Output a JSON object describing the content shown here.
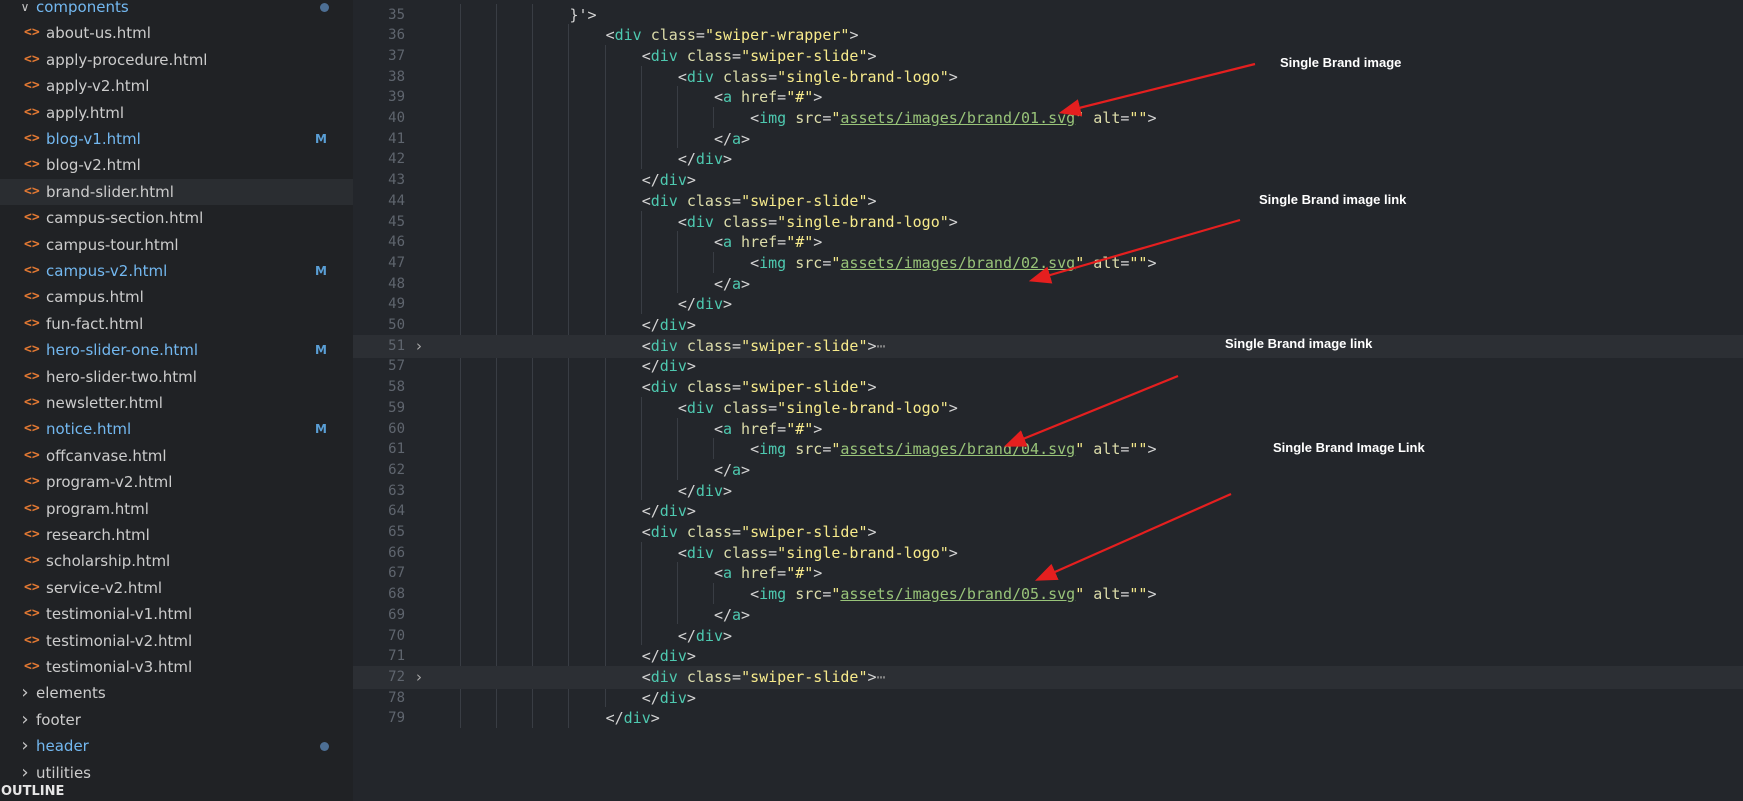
{
  "explorer": {
    "top_folder": "components",
    "files": [
      {
        "name": "about-us.html",
        "status": ""
      },
      {
        "name": "apply-procedure.html",
        "status": ""
      },
      {
        "name": "apply-v2.html",
        "status": ""
      },
      {
        "name": "apply.html",
        "status": ""
      },
      {
        "name": "blog-v1.html",
        "status": "M"
      },
      {
        "name": "blog-v2.html",
        "status": ""
      },
      {
        "name": "brand-slider.html",
        "status": ""
      },
      {
        "name": "campus-section.html",
        "status": ""
      },
      {
        "name": "campus-tour.html",
        "status": ""
      },
      {
        "name": "campus-v2.html",
        "status": "M"
      },
      {
        "name": "campus.html",
        "status": ""
      },
      {
        "name": "fun-fact.html",
        "status": ""
      },
      {
        "name": "hero-slider-one.html",
        "status": "M"
      },
      {
        "name": "hero-slider-two.html",
        "status": ""
      },
      {
        "name": "newsletter.html",
        "status": ""
      },
      {
        "name": "notice.html",
        "status": "M"
      },
      {
        "name": "offcanvase.html",
        "status": ""
      },
      {
        "name": "program-v2.html",
        "status": ""
      },
      {
        "name": "program.html",
        "status": ""
      },
      {
        "name": "research.html",
        "status": ""
      },
      {
        "name": "scholarship.html",
        "status": ""
      },
      {
        "name": "service-v2.html",
        "status": ""
      },
      {
        "name": "testimonial-v1.html",
        "status": ""
      },
      {
        "name": "testimonial-v2.html",
        "status": ""
      },
      {
        "name": "testimonial-v3.html",
        "status": ""
      }
    ],
    "folders": [
      {
        "name": "elements",
        "modified": false
      },
      {
        "name": "footer",
        "modified": false
      },
      {
        "name": "header",
        "modified": true
      },
      {
        "name": "utilities",
        "modified": false
      }
    ],
    "selected_file": "brand-slider.html",
    "outline_label": "OUTLINE"
  },
  "editor": {
    "lines": [
      {
        "num": "35",
        "indent": 4,
        "tokens": [
          [
            "p",
            "}'>"
          ]
        ]
      },
      {
        "num": "36",
        "indent": 5,
        "tokens": [
          [
            "p",
            "<"
          ],
          [
            "t",
            "div"
          ],
          [
            "p",
            " "
          ],
          [
            "a",
            "class"
          ],
          [
            "p",
            "="
          ],
          [
            "s",
            "\"swiper-wrapper\""
          ],
          [
            "p",
            ">"
          ]
        ]
      },
      {
        "num": "37",
        "indent": 6,
        "tokens": [
          [
            "p",
            "<"
          ],
          [
            "t",
            "div"
          ],
          [
            "p",
            " "
          ],
          [
            "a",
            "class"
          ],
          [
            "p",
            "="
          ],
          [
            "s",
            "\"swiper-slide\""
          ],
          [
            "p",
            ">"
          ]
        ]
      },
      {
        "num": "38",
        "indent": 7,
        "tokens": [
          [
            "p",
            "<"
          ],
          [
            "t",
            "div"
          ],
          [
            "p",
            " "
          ],
          [
            "a",
            "class"
          ],
          [
            "p",
            "="
          ],
          [
            "s",
            "\"single-brand-logo\""
          ],
          [
            "p",
            ">"
          ]
        ]
      },
      {
        "num": "39",
        "indent": 8,
        "tokens": [
          [
            "p",
            "<"
          ],
          [
            "t",
            "a"
          ],
          [
            "p",
            " "
          ],
          [
            "a",
            "href"
          ],
          [
            "p",
            "="
          ],
          [
            "s",
            "\"#\""
          ],
          [
            "p",
            ">"
          ]
        ]
      },
      {
        "num": "40",
        "indent": 9,
        "tokens": [
          [
            "p",
            "<"
          ],
          [
            "t",
            "img"
          ],
          [
            "p",
            " "
          ],
          [
            "a",
            "src"
          ],
          [
            "p",
            "="
          ],
          [
            "s",
            "\""
          ],
          [
            "sl",
            "assets/images/brand/01.svg"
          ],
          [
            "s",
            "\""
          ],
          [
            "p",
            " "
          ],
          [
            "a",
            "alt"
          ],
          [
            "p",
            "="
          ],
          [
            "s",
            "\"\""
          ],
          [
            "p",
            ">"
          ]
        ]
      },
      {
        "num": "41",
        "indent": 8,
        "tokens": [
          [
            "p",
            "</"
          ],
          [
            "t",
            "a"
          ],
          [
            "p",
            ">"
          ]
        ]
      },
      {
        "num": "42",
        "indent": 7,
        "tokens": [
          [
            "p",
            "</"
          ],
          [
            "t",
            "div"
          ],
          [
            "p",
            ">"
          ]
        ]
      },
      {
        "num": "43",
        "indent": 6,
        "tokens": [
          [
            "p",
            "</"
          ],
          [
            "t",
            "div"
          ],
          [
            "p",
            ">"
          ]
        ]
      },
      {
        "num": "44",
        "indent": 6,
        "tokens": [
          [
            "p",
            "<"
          ],
          [
            "t",
            "div"
          ],
          [
            "p",
            " "
          ],
          [
            "a",
            "class"
          ],
          [
            "p",
            "="
          ],
          [
            "s",
            "\"swiper-slide\""
          ],
          [
            "p",
            ">"
          ]
        ]
      },
      {
        "num": "45",
        "indent": 7,
        "tokens": [
          [
            "p",
            "<"
          ],
          [
            "t",
            "div"
          ],
          [
            "p",
            " "
          ],
          [
            "a",
            "class"
          ],
          [
            "p",
            "="
          ],
          [
            "s",
            "\"single-brand-logo\""
          ],
          [
            "p",
            ">"
          ]
        ]
      },
      {
        "num": "46",
        "indent": 8,
        "tokens": [
          [
            "p",
            "<"
          ],
          [
            "t",
            "a"
          ],
          [
            "p",
            " "
          ],
          [
            "a",
            "href"
          ],
          [
            "p",
            "="
          ],
          [
            "s",
            "\"#\""
          ],
          [
            "p",
            ">"
          ]
        ]
      },
      {
        "num": "47",
        "indent": 9,
        "tokens": [
          [
            "p",
            "<"
          ],
          [
            "t",
            "img"
          ],
          [
            "p",
            " "
          ],
          [
            "a",
            "src"
          ],
          [
            "p",
            "="
          ],
          [
            "s",
            "\""
          ],
          [
            "sl",
            "assets/images/brand/02.svg"
          ],
          [
            "s",
            "\""
          ],
          [
            "p",
            " "
          ],
          [
            "a",
            "alt"
          ],
          [
            "p",
            "="
          ],
          [
            "s",
            "\"\""
          ],
          [
            "p",
            ">"
          ]
        ]
      },
      {
        "num": "48",
        "indent": 8,
        "tokens": [
          [
            "p",
            "</"
          ],
          [
            "t",
            "a"
          ],
          [
            "p",
            ">"
          ]
        ]
      },
      {
        "num": "49",
        "indent": 7,
        "tokens": [
          [
            "p",
            "</"
          ],
          [
            "t",
            "div"
          ],
          [
            "p",
            ">"
          ]
        ]
      },
      {
        "num": "50",
        "indent": 6,
        "tokens": [
          [
            "p",
            "</"
          ],
          [
            "t",
            "div"
          ],
          [
            "p",
            ">"
          ]
        ]
      },
      {
        "num": "51",
        "indent": 6,
        "folded": true,
        "tokens": [
          [
            "p",
            "<"
          ],
          [
            "t",
            "div"
          ],
          [
            "p",
            " "
          ],
          [
            "a",
            "class"
          ],
          [
            "p",
            "="
          ],
          [
            "s",
            "\"swiper-slide\""
          ],
          [
            "p",
            ">"
          ],
          [
            "e",
            "⋯"
          ]
        ]
      },
      {
        "num": "57",
        "indent": 6,
        "tokens": [
          [
            "p",
            "</"
          ],
          [
            "t",
            "div"
          ],
          [
            "p",
            ">"
          ]
        ]
      },
      {
        "num": "58",
        "indent": 6,
        "tokens": [
          [
            "p",
            "<"
          ],
          [
            "t",
            "div"
          ],
          [
            "p",
            " "
          ],
          [
            "a",
            "class"
          ],
          [
            "p",
            "="
          ],
          [
            "s",
            "\"swiper-slide\""
          ],
          [
            "p",
            ">"
          ]
        ]
      },
      {
        "num": "59",
        "indent": 7,
        "tokens": [
          [
            "p",
            "<"
          ],
          [
            "t",
            "div"
          ],
          [
            "p",
            " "
          ],
          [
            "a",
            "class"
          ],
          [
            "p",
            "="
          ],
          [
            "s",
            "\"single-brand-logo\""
          ],
          [
            "p",
            ">"
          ]
        ]
      },
      {
        "num": "60",
        "indent": 8,
        "tokens": [
          [
            "p",
            "<"
          ],
          [
            "t",
            "a"
          ],
          [
            "p",
            " "
          ],
          [
            "a",
            "href"
          ],
          [
            "p",
            "="
          ],
          [
            "s",
            "\"#\""
          ],
          [
            "p",
            ">"
          ]
        ]
      },
      {
        "num": "61",
        "indent": 9,
        "tokens": [
          [
            "p",
            "<"
          ],
          [
            "t",
            "img"
          ],
          [
            "p",
            " "
          ],
          [
            "a",
            "src"
          ],
          [
            "p",
            "="
          ],
          [
            "s",
            "\""
          ],
          [
            "sl",
            "assets/images/brand/04.svg"
          ],
          [
            "s",
            "\""
          ],
          [
            "p",
            " "
          ],
          [
            "a",
            "alt"
          ],
          [
            "p",
            "="
          ],
          [
            "s",
            "\"\""
          ],
          [
            "p",
            ">"
          ]
        ]
      },
      {
        "num": "62",
        "indent": 8,
        "tokens": [
          [
            "p",
            "</"
          ],
          [
            "t",
            "a"
          ],
          [
            "p",
            ">"
          ]
        ]
      },
      {
        "num": "63",
        "indent": 7,
        "tokens": [
          [
            "p",
            "</"
          ],
          [
            "t",
            "div"
          ],
          [
            "p",
            ">"
          ]
        ]
      },
      {
        "num": "64",
        "indent": 6,
        "tokens": [
          [
            "p",
            "</"
          ],
          [
            "t",
            "div"
          ],
          [
            "p",
            ">"
          ]
        ]
      },
      {
        "num": "65",
        "indent": 6,
        "tokens": [
          [
            "p",
            "<"
          ],
          [
            "t",
            "div"
          ],
          [
            "p",
            " "
          ],
          [
            "a",
            "class"
          ],
          [
            "p",
            "="
          ],
          [
            "s",
            "\"swiper-slide\""
          ],
          [
            "p",
            ">"
          ]
        ]
      },
      {
        "num": "66",
        "indent": 7,
        "tokens": [
          [
            "p",
            "<"
          ],
          [
            "t",
            "div"
          ],
          [
            "p",
            " "
          ],
          [
            "a",
            "class"
          ],
          [
            "p",
            "="
          ],
          [
            "s",
            "\"single-brand-logo\""
          ],
          [
            "p",
            ">"
          ]
        ]
      },
      {
        "num": "67",
        "indent": 8,
        "tokens": [
          [
            "p",
            "<"
          ],
          [
            "t",
            "a"
          ],
          [
            "p",
            " "
          ],
          [
            "a",
            "href"
          ],
          [
            "p",
            "="
          ],
          [
            "s",
            "\"#\""
          ],
          [
            "p",
            ">"
          ]
        ]
      },
      {
        "num": "68",
        "indent": 9,
        "tokens": [
          [
            "p",
            "<"
          ],
          [
            "t",
            "img"
          ],
          [
            "p",
            " "
          ],
          [
            "a",
            "src"
          ],
          [
            "p",
            "="
          ],
          [
            "s",
            "\""
          ],
          [
            "sl",
            "assets/images/brand/05.svg"
          ],
          [
            "s",
            "\""
          ],
          [
            "p",
            " "
          ],
          [
            "a",
            "alt"
          ],
          [
            "p",
            "="
          ],
          [
            "s",
            "\"\""
          ],
          [
            "p",
            ">"
          ]
        ]
      },
      {
        "num": "69",
        "indent": 8,
        "tokens": [
          [
            "p",
            "</"
          ],
          [
            "t",
            "a"
          ],
          [
            "p",
            ">"
          ]
        ]
      },
      {
        "num": "70",
        "indent": 7,
        "tokens": [
          [
            "p",
            "</"
          ],
          [
            "t",
            "div"
          ],
          [
            "p",
            ">"
          ]
        ]
      },
      {
        "num": "71",
        "indent": 6,
        "tokens": [
          [
            "p",
            "</"
          ],
          [
            "t",
            "div"
          ],
          [
            "p",
            ">"
          ]
        ]
      },
      {
        "num": "72",
        "indent": 6,
        "folded": true,
        "tokens": [
          [
            "p",
            "<"
          ],
          [
            "t",
            "div"
          ],
          [
            "p",
            " "
          ],
          [
            "a",
            "class"
          ],
          [
            "p",
            "="
          ],
          [
            "s",
            "\"swiper-slide\""
          ],
          [
            "p",
            ">"
          ],
          [
            "e",
            "⋯"
          ]
        ]
      },
      {
        "num": "78",
        "indent": 6,
        "tokens": [
          [
            "p",
            "</"
          ],
          [
            "t",
            "div"
          ],
          [
            "p",
            ">"
          ]
        ]
      },
      {
        "num": "79",
        "indent": 5,
        "tokens": [
          [
            "p",
            "</"
          ],
          [
            "t",
            "div"
          ],
          [
            "p",
            ">"
          ]
        ]
      }
    ],
    "annotations": [
      {
        "text": "Single Brand image",
        "line": "39"
      },
      {
        "text": "Single Brand image link",
        "line": "46"
      },
      {
        "text": "Single Brand image link",
        "line": "61"
      },
      {
        "text": "Single Brand Image Link",
        "line": "67"
      }
    ],
    "colors": {
      "arrow": "#e51f1f",
      "tag": "#4ec9b0",
      "attr": "#dcdcaa",
      "string": "#f7ea8b",
      "link": "#98c379"
    }
  }
}
